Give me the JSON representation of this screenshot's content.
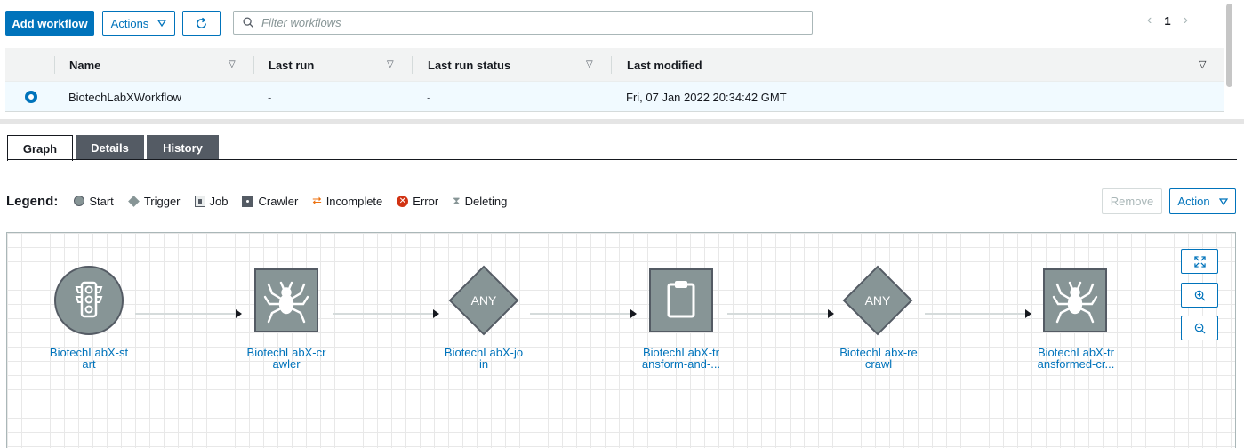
{
  "toolbar": {
    "add_workflow_label": "Add workflow",
    "actions_label": "Actions",
    "search_placeholder": "Filter workflows",
    "page_number": "1"
  },
  "table": {
    "columns": [
      "Name",
      "Last run",
      "Last run status",
      "Last modified"
    ],
    "rows": [
      {
        "name": "BiotechLabXWorkflow",
        "last_run": "-",
        "last_run_status": "-",
        "last_modified": "Fri, 07 Jan 2022 20:34:42 GMT",
        "selected": true
      }
    ]
  },
  "tabs": [
    "Graph",
    "Details",
    "History"
  ],
  "active_tab": "Graph",
  "legend": {
    "title": "Legend:",
    "items": [
      "Start",
      "Trigger",
      "Job",
      "Crawler",
      "Incomplete",
      "Error",
      "Deleting"
    ]
  },
  "graph_actions": {
    "remove_label": "Remove",
    "action_label": "Action"
  },
  "graph": {
    "nodes": [
      {
        "type": "start",
        "icon": "traffic-light-icon",
        "label_l1": "BiotechLabX-st",
        "label_l2": "art"
      },
      {
        "type": "crawler",
        "icon": "spider-icon",
        "label_l1": "BiotechLabX-cr",
        "label_l2": "awler"
      },
      {
        "type": "trigger",
        "text": "ANY",
        "label_l1": "BiotechLabX-jo",
        "label_l2": "in"
      },
      {
        "type": "job",
        "icon": "clipboard-icon",
        "label_l1": "BiotechLabX-tr",
        "label_l2": "ansform-and-..."
      },
      {
        "type": "trigger",
        "text": "ANY",
        "label_l1": "BiotechLabx-re",
        "label_l2": "crawl"
      },
      {
        "type": "crawler",
        "icon": "spider-icon",
        "label_l1": "BiotechLabX-tr",
        "label_l2": "ansformed-cr..."
      }
    ]
  },
  "colors": {
    "primary": "#0073bb",
    "node_fill": "#879596",
    "node_border": "#545b64",
    "link": "#0073bb"
  }
}
